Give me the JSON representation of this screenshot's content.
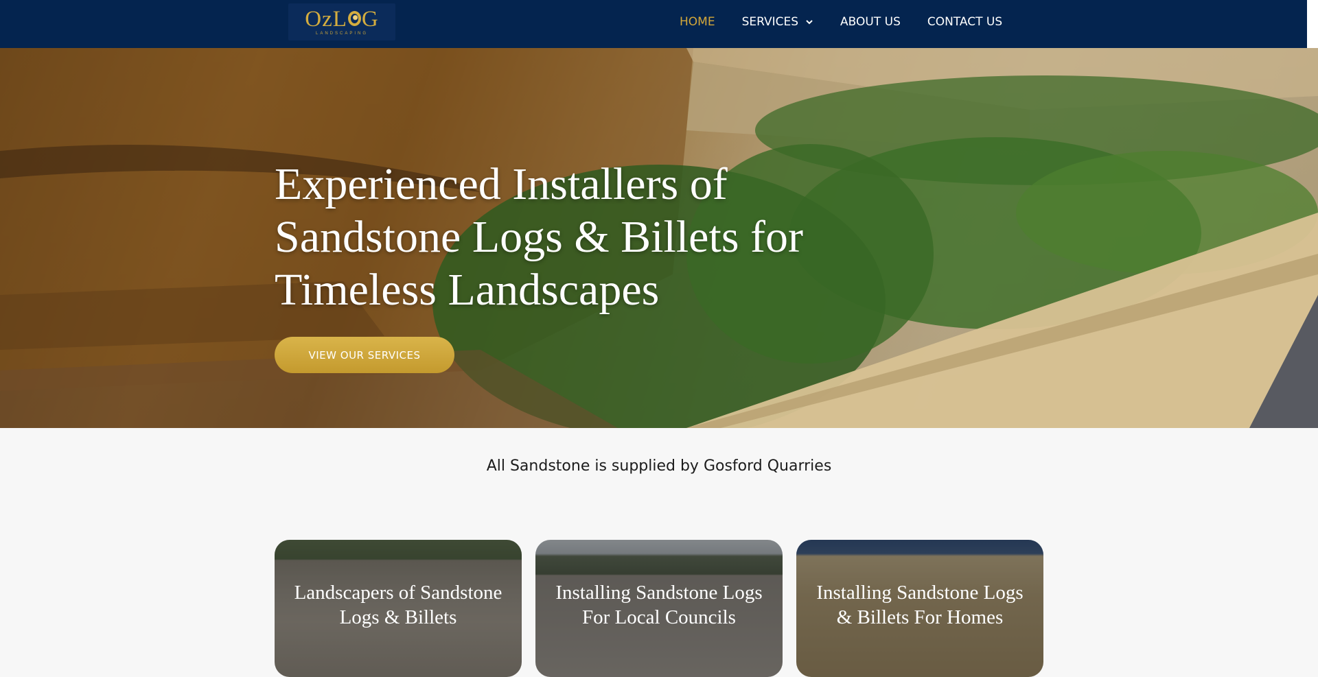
{
  "brand": {
    "logo_prefix": "Oz",
    "logo_l": "L",
    "logo_suffix": "G",
    "logo_sub": "LANDSCAPING",
    "color_navy": "#04244f",
    "color_gold": "#d4a83a"
  },
  "nav": {
    "items": [
      {
        "label": "HOME",
        "active": true
      },
      {
        "label": "SERVICES",
        "has_dropdown": true,
        "icon": "chevron-down-icon"
      },
      {
        "label": "ABOUT US"
      },
      {
        "label": "CONTACT US"
      }
    ]
  },
  "hero": {
    "title": "Experienced Installers of Sandstone Logs & Billets for Timeless Landscapes",
    "cta_label": "VIEW OUR SERVICES"
  },
  "tagline": "All Sandstone is supplied by Gosford Quarries",
  "cards": [
    {
      "title": "Landscapers of Sandstone Logs & Billets"
    },
    {
      "title": "Installing Sandstone Logs For Local Councils"
    },
    {
      "title": "Installing Sandstone Logs & Billets For Homes"
    }
  ]
}
